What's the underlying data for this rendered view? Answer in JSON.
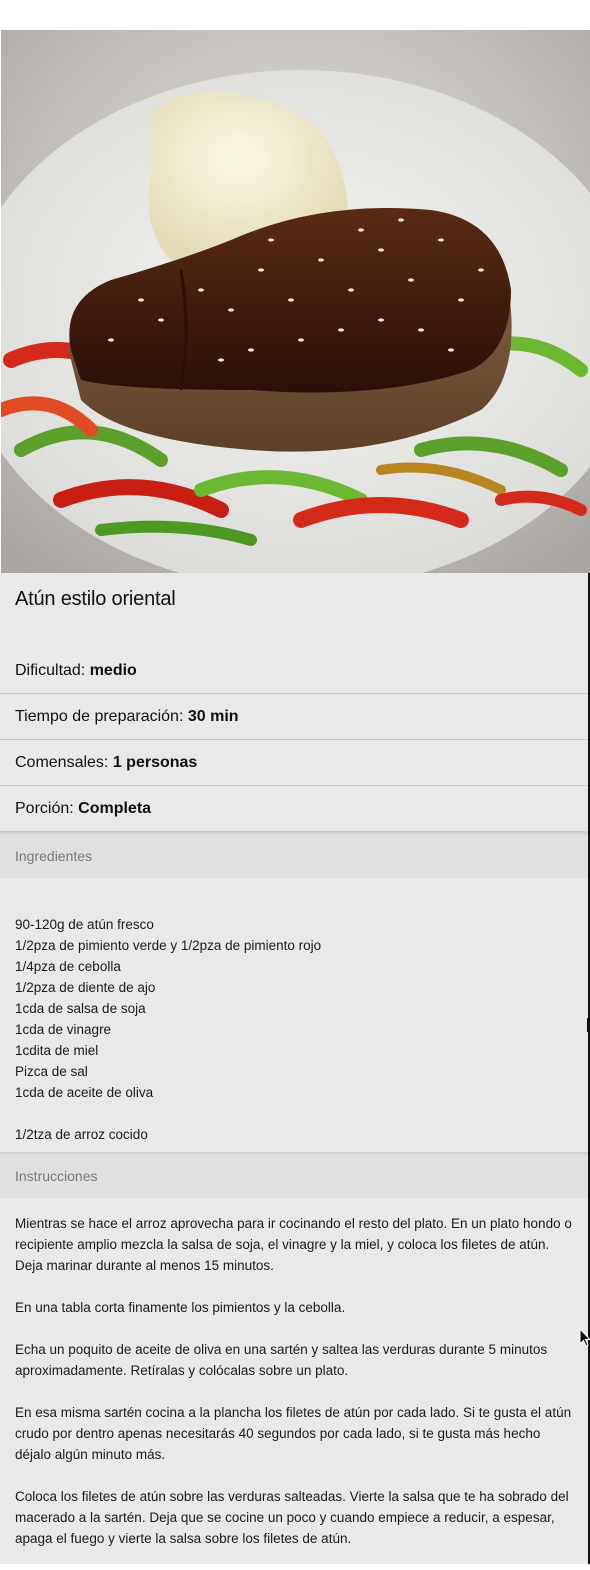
{
  "recipe": {
    "title": "Atún estilo oriental",
    "difficulty_label": "Dificultad:",
    "difficulty_value": "medio",
    "time_label": "Tiempo de preparación:",
    "time_value": "30 min",
    "servings_label": "Comensales:",
    "servings_value": "1 personas",
    "portion_label": "Porción:",
    "portion_value": "Completa"
  },
  "ingredients": {
    "heading": "Ingredientes",
    "items": [
      "90-120g de atún fresco",
      "1/2pza de pimiento verde y 1/2pza de pimiento rojo",
      "1/4pza de cebolla",
      "1/2pza de diente de ajo",
      "1cda de salsa de soja",
      "1cda de vinagre",
      "1cdita de miel",
      "Pizca de sal",
      "1cda de aceite de oliva",
      "1/2tza de arroz cocido"
    ]
  },
  "instructions": {
    "heading": "Instrucciones",
    "steps": [
      "Mientras se hace el arroz aprovecha para ir cocinando el resto del plato. En un plato hondo o recipiente amplio mezcla la salsa de soja, el vinagre y la miel, y coloca los filetes de atún. Deja marinar durante al menos 15 minutos.",
      "En una tabla corta finamente los pimientos y la cebolla.",
      "Echa un poquito de aceite de oliva en una sartén y saltea las verduras durante 5 minutos aproximadamente. Retíralas y colócalas sobre un plato.",
      "En esa misma sartén cocina a la plancha los filetes de atún por cada lado. Si te gusta el atún crudo por dentro apenas necesitarás 40 segundos por cada lado, si te gusta más hecho déjalo algún minuto más.",
      "Coloca los filetes de atún sobre las verduras salteadas. Vierte la salsa que te ha sobrado del macerado a la sartén. Deja que se cocine un poco y cuando empiece a reducir, a espesar, apaga el fuego y vierte la salsa sobre los filetes de atún."
    ]
  },
  "colors": {
    "panel_bg": "#e9e9e9",
    "section_head_bg": "#e0e0e0",
    "section_head_text": "#777777",
    "divider": "#c8c8c8"
  },
  "icons": {
    "cursor": "mouse-pointer-icon"
  }
}
